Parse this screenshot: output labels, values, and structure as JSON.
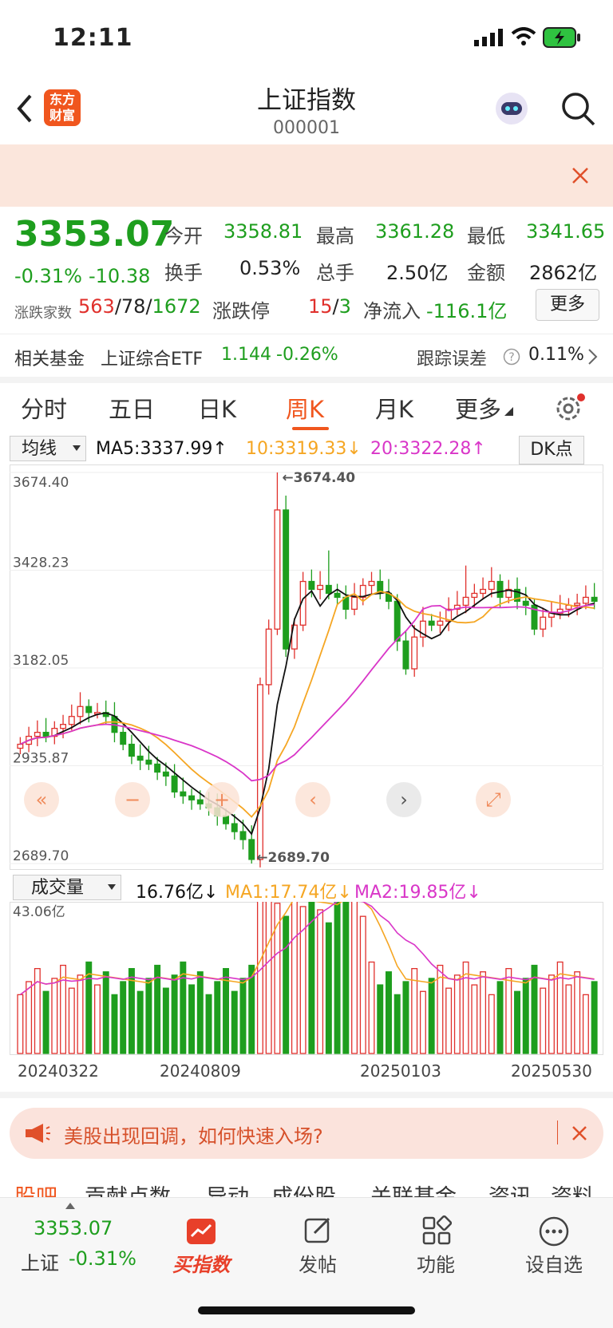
{
  "status": {
    "time": "12:11"
  },
  "header": {
    "title": "上证指数",
    "code": "000001",
    "logo_line1": "东方",
    "logo_line2": "财富"
  },
  "quote": {
    "price": "3353.07",
    "change_pct": "-0.31%",
    "change": "-10.38",
    "open_label": "今开",
    "open": "3358.81",
    "high_label": "最高",
    "high": "3361.28",
    "low_label": "最低",
    "low": "3341.65",
    "turnover_label": "换手",
    "turnover": "0.53%",
    "volume_label": "总手",
    "volume": "2.50亿",
    "amount_label": "金额",
    "amount": "2862亿",
    "breadth_label": "涨跌家数",
    "breadth_up": "563",
    "breadth_flat": "78",
    "breadth_down": "1672",
    "limit_label": "涨跌停",
    "limit_up": "15",
    "limit_down": "3",
    "inflow_label": "净流入",
    "inflow": "-116.1亿",
    "more_label": "更多"
  },
  "fund": {
    "label": "相关基金",
    "name": "上证综合ETF",
    "price": "1.144",
    "pct": "-0.26%",
    "track_label": "跟踪误差",
    "track_value": "0.11%"
  },
  "tabs": [
    "分时",
    "五日",
    "日K",
    "周K",
    "月K",
    "更多"
  ],
  "active_tab": "周K",
  "ma_bar": {
    "select": "均线",
    "ma5": "MA5:3337.99",
    "ma10": "10:3319.33",
    "ma20": "20:3322.28",
    "dk": "DK点"
  },
  "vol_bar": {
    "select": "成交量",
    "vol": "16.76亿",
    "ma1": "MA1:17.74亿",
    "ma2": "MA2:19.85亿"
  },
  "chart_data": {
    "type": "candlestick",
    "y_ticks": [
      "3674.40",
      "3428.23",
      "3182.05",
      "2935.87",
      "2689.70"
    ],
    "ylim": [
      2689.7,
      3674.4
    ],
    "max_label": "3674.40",
    "min_label": "2689.70",
    "vol_max_label": "43.06亿",
    "x_labels": [
      "20240322",
      "20240809",
      "20250103",
      "20250530"
    ],
    "colors": {
      "up": "#e0302c",
      "down": "#1e9e1e",
      "ma5": "#111111",
      "ma10": "#f5a623",
      "ma20": "#d936c8"
    }
  },
  "notice": {
    "text": "美股出现回调，如何快速入场?"
  },
  "subtabs": [
    "股吧",
    "贡献点数",
    "异动",
    "成份股",
    "关联基金",
    "资讯",
    "资料"
  ],
  "bottom": {
    "price": "3353.07",
    "name": "上证",
    "pct": "-0.31%",
    "nav": [
      "买指数",
      "发帖",
      "功能",
      "设自选"
    ]
  }
}
